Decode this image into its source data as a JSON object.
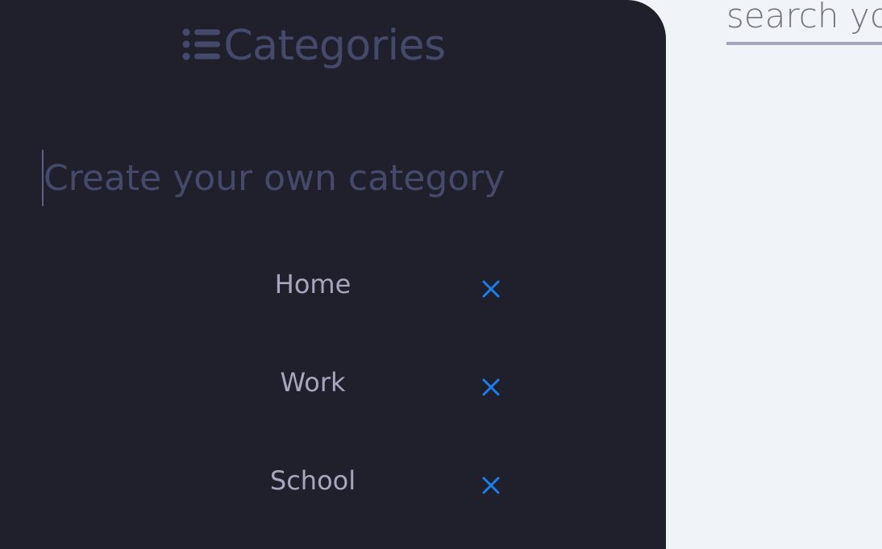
{
  "sidebar": {
    "title": "Categories",
    "title_icon": "list-icon",
    "new_category": {
      "placeholder": "Create your own category",
      "value": ""
    },
    "categories": [
      {
        "label": "Home",
        "delete_icon": "close-icon"
      },
      {
        "label": "Work",
        "delete_icon": "close-icon"
      },
      {
        "label": "School",
        "delete_icon": "close-icon"
      }
    ]
  },
  "main": {
    "search": {
      "placeholder": "search your notes",
      "value": ""
    }
  },
  "colors": {
    "sidebar_bg": "#20202d",
    "main_bg": "#f0f4f8",
    "title_color": "#454a6b",
    "category_label": "#a5a7bd",
    "delete_accent": "#1a7ff0",
    "search_underline": "#a4a5b8"
  }
}
